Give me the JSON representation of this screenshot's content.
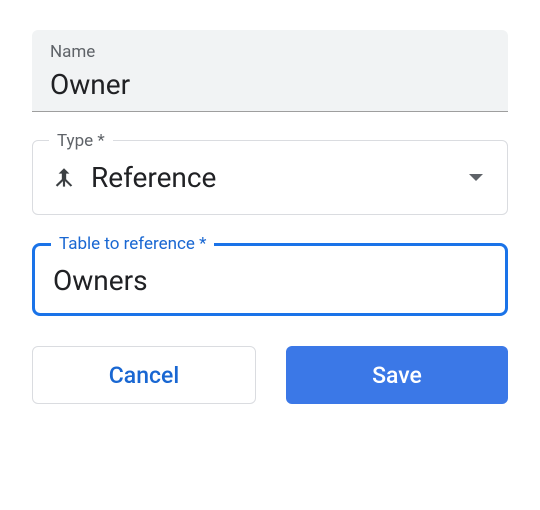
{
  "name_field": {
    "label": "Name",
    "value": "Owner"
  },
  "type_field": {
    "label": "Type *",
    "value": "Reference",
    "icon": "merge-icon"
  },
  "table_ref_field": {
    "label": "Table to reference *",
    "value": "Owners"
  },
  "buttons": {
    "cancel_label": "Cancel",
    "save_label": "Save"
  }
}
